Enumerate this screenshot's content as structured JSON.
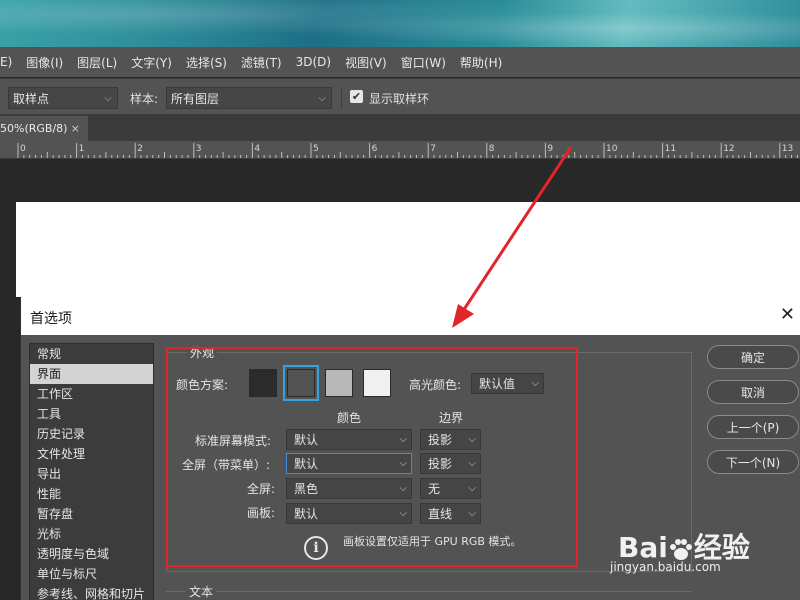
{
  "menubar": {
    "items": [
      "E)",
      "图像(I)",
      "图层(L)",
      "文字(Y)",
      "选择(S)",
      "滤镜(T)",
      "3D(D)",
      "视图(V)",
      "窗口(W)",
      "帮助(H)"
    ]
  },
  "options_bar": {
    "sample_size_value": "取样点",
    "sample_label": "样本:",
    "sample_value": "所有图层",
    "show_ring_label": "显示取样环",
    "show_ring_checked": true
  },
  "document_tab": {
    "title": "50%(RGB/8)",
    "close_glyph": "×"
  },
  "ruler": {
    "numbers": [
      "0",
      "1",
      "2",
      "3",
      "4",
      "5",
      "6",
      "7",
      "8",
      "9",
      "10",
      "11",
      "12",
      "13"
    ]
  },
  "dialog": {
    "title": "首选项",
    "close_glyph": "✕",
    "sidebar": [
      "常规",
      "界面",
      "工作区",
      "工具",
      "历史记录",
      "文件处理",
      "导出",
      "性能",
      "暂存盘",
      "光标",
      "透明度与色域",
      "单位与标尺",
      "参考线、网格和切片"
    ],
    "selected_index": 1,
    "appearance": {
      "group_label": "外观",
      "color_scheme_label": "颜色方案:",
      "swatch_colors": [
        "#2b2b2b",
        "#535353",
        "#b8b8b8",
        "#f0f0f0"
      ],
      "selected_swatch": 1,
      "highlight_color_label": "高光颜色:",
      "highlight_color_value": "默认值",
      "col_color": "颜色",
      "col_border": "边界",
      "rows": [
        {
          "label": "标准屏幕模式:",
          "color": "默认",
          "border": "投影"
        },
        {
          "label": "全屏（带菜单）:",
          "color": "默认",
          "border": "投影"
        },
        {
          "label": "全屏:",
          "color": "黑色",
          "border": "无"
        },
        {
          "label": "画板:",
          "color": "默认",
          "border": "直线"
        }
      ],
      "info_text": "画板设置仅适用于 GPU RGB 模式。"
    },
    "text_group_label": "文本",
    "buttons": {
      "ok": "确定",
      "cancel": "取消",
      "prev": "上一个(P)",
      "next": "下一个(N)"
    }
  },
  "annotation": {
    "box_color": "#e0252b",
    "arrow_color": "#e0252b"
  },
  "watermark": {
    "brand": "Bai",
    "brand_suffix": "经验",
    "url": "jingyan.baidu.com"
  }
}
